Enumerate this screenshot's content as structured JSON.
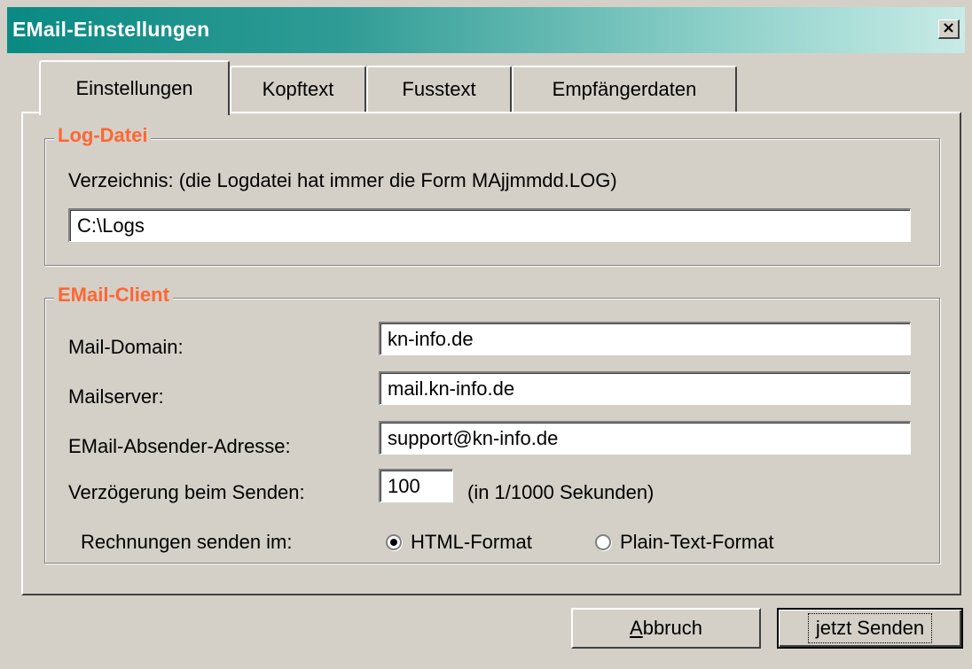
{
  "window": {
    "title": "EMail-Einstellungen",
    "close_glyph": "×"
  },
  "tabs": [
    {
      "label": "Einstellungen",
      "active": true
    },
    {
      "label": "Kopftext",
      "active": false
    },
    {
      "label": "Fusstext",
      "active": false
    },
    {
      "label": "Empfängerdaten",
      "active": false
    }
  ],
  "log_group": {
    "title": "Log-Datei",
    "directory_label": "Verzeichnis: (die Logdatei hat immer die Form MAjjmmdd.LOG)",
    "directory_value": "C:\\Logs"
  },
  "email_group": {
    "title": "EMail-Client",
    "domain_label": "Mail-Domain:",
    "domain_value": "kn-info.de",
    "server_label": "Mailserver:",
    "server_value": "mail.kn-info.de",
    "sender_label": "EMail-Absender-Adresse:",
    "sender_value": "support@kn-info.de",
    "delay_label": "Verzögerung beim Senden:",
    "delay_value": "100",
    "delay_unit": "(in 1/1000 Sekunden)",
    "format_label": "Rechnungen senden im:",
    "format_options": [
      {
        "label": "HTML-Format",
        "selected": true
      },
      {
        "label": "Plain-Text-Format",
        "selected": false
      }
    ]
  },
  "buttons": {
    "cancel_first": "A",
    "cancel_rest": "bbruch",
    "send_label": "jetzt Senden"
  },
  "colors": {
    "group_title": "#ff6633",
    "title_gradient_start": "#0a8a84"
  }
}
